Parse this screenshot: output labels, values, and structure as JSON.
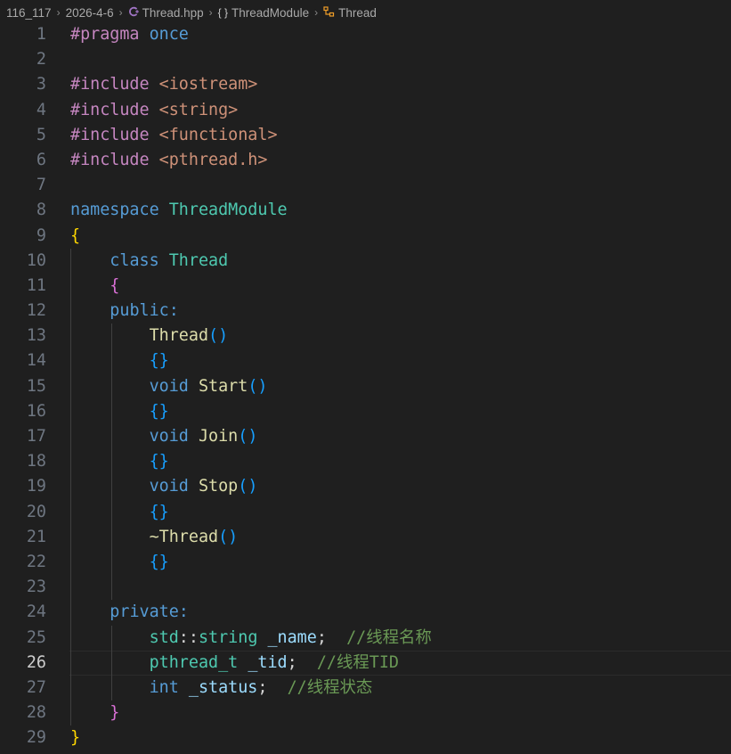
{
  "breadcrumb": {
    "segments": [
      {
        "label": "116_117",
        "icon": ""
      },
      {
        "label": "2026-4-6",
        "icon": ""
      },
      {
        "label": "Thread.hpp",
        "icon": "cpp-file-icon"
      },
      {
        "label": "ThreadModule",
        "icon": "namespace-braces-icon"
      },
      {
        "label": "Thread",
        "icon": "class-icon"
      }
    ],
    "separator": "›"
  },
  "editor": {
    "current_line": 26,
    "lines": [
      {
        "n": "1",
        "t": [
          [
            "#pragma ",
            "kw-pp"
          ],
          [
            "once",
            "kw"
          ]
        ]
      },
      {
        "n": "2",
        "t": []
      },
      {
        "n": "3",
        "t": [
          [
            "#include ",
            "kw-pp"
          ],
          [
            "<iostream>",
            "inc"
          ]
        ]
      },
      {
        "n": "4",
        "t": [
          [
            "#include ",
            "kw-pp"
          ],
          [
            "<string>",
            "inc"
          ]
        ]
      },
      {
        "n": "5",
        "t": [
          [
            "#include ",
            "kw-pp"
          ],
          [
            "<functional>",
            "inc"
          ]
        ]
      },
      {
        "n": "6",
        "t": [
          [
            "#include ",
            "kw-pp"
          ],
          [
            "<pthread.h>",
            "inc"
          ]
        ]
      },
      {
        "n": "7",
        "t": []
      },
      {
        "n": "8",
        "t": [
          [
            "namespace ",
            "kw"
          ],
          [
            "ThreadModule",
            "type"
          ]
        ]
      },
      {
        "n": "9",
        "t": [
          [
            "{",
            "b1"
          ]
        ]
      },
      {
        "n": "10",
        "t": [
          [
            "    ",
            "txt"
          ],
          [
            "class ",
            "kw"
          ],
          [
            "Thread",
            "type"
          ]
        ]
      },
      {
        "n": "11",
        "t": [
          [
            "    ",
            "txt"
          ],
          [
            "{",
            "b2"
          ]
        ]
      },
      {
        "n": "12",
        "t": [
          [
            "    ",
            "txt"
          ],
          [
            "public:",
            "kw"
          ]
        ]
      },
      {
        "n": "13",
        "t": [
          [
            "        ",
            "txt"
          ],
          [
            "Thread",
            "fn"
          ],
          [
            "()",
            "b3"
          ]
        ]
      },
      {
        "n": "14",
        "t": [
          [
            "        ",
            "txt"
          ],
          [
            "{}",
            "b3"
          ]
        ]
      },
      {
        "n": "15",
        "t": [
          [
            "        ",
            "txt"
          ],
          [
            "void ",
            "kw"
          ],
          [
            "Start",
            "fn"
          ],
          [
            "()",
            "b3"
          ]
        ]
      },
      {
        "n": "16",
        "t": [
          [
            "        ",
            "txt"
          ],
          [
            "{}",
            "b3"
          ]
        ]
      },
      {
        "n": "17",
        "t": [
          [
            "        ",
            "txt"
          ],
          [
            "void ",
            "kw"
          ],
          [
            "Join",
            "fn"
          ],
          [
            "()",
            "b3"
          ]
        ]
      },
      {
        "n": "18",
        "t": [
          [
            "        ",
            "txt"
          ],
          [
            "{}",
            "b3"
          ]
        ]
      },
      {
        "n": "19",
        "t": [
          [
            "        ",
            "txt"
          ],
          [
            "void ",
            "kw"
          ],
          [
            "Stop",
            "fn"
          ],
          [
            "()",
            "b3"
          ]
        ]
      },
      {
        "n": "20",
        "t": [
          [
            "        ",
            "txt"
          ],
          [
            "{}",
            "b3"
          ]
        ]
      },
      {
        "n": "21",
        "t": [
          [
            "        ",
            "txt"
          ],
          [
            "~Thread",
            "fn"
          ],
          [
            "()",
            "b3"
          ]
        ]
      },
      {
        "n": "22",
        "t": [
          [
            "        ",
            "txt"
          ],
          [
            "{}",
            "b3"
          ]
        ]
      },
      {
        "n": "23",
        "t": []
      },
      {
        "n": "24",
        "t": [
          [
            "    ",
            "txt"
          ],
          [
            "private:",
            "kw"
          ]
        ]
      },
      {
        "n": "25",
        "t": [
          [
            "        ",
            "txt"
          ],
          [
            "std",
            "type"
          ],
          [
            "::",
            "txt"
          ],
          [
            "string ",
            "type"
          ],
          [
            "_name",
            "var"
          ],
          [
            ";  ",
            "txt"
          ],
          [
            "//线程名称",
            "cmt"
          ]
        ]
      },
      {
        "n": "26",
        "t": [
          [
            "        ",
            "txt"
          ],
          [
            "pthread_t ",
            "type"
          ],
          [
            "_tid",
            "var"
          ],
          [
            ";  ",
            "txt"
          ],
          [
            "//线程TID",
            "cmt"
          ]
        ]
      },
      {
        "n": "27",
        "t": [
          [
            "        ",
            "txt"
          ],
          [
            "int ",
            "kw"
          ],
          [
            "_status",
            "var"
          ],
          [
            ";  ",
            "txt"
          ],
          [
            "//线程状态",
            "cmt"
          ]
        ]
      },
      {
        "n": "28",
        "t": [
          [
            "    ",
            "txt"
          ],
          [
            "}",
            "b2"
          ]
        ]
      },
      {
        "n": "29",
        "t": [
          [
            "}",
            "b1"
          ]
        ]
      }
    ]
  }
}
